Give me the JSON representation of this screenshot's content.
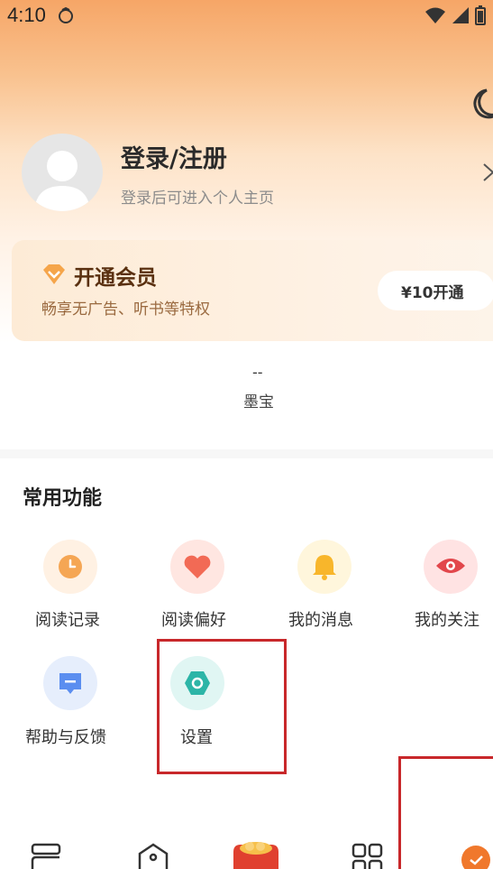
{
  "status_bar": {
    "time": "4:10"
  },
  "profile": {
    "login_title": "登录/注册",
    "login_subtitle": "登录后可进入个人主页"
  },
  "vip": {
    "title": "开通会员",
    "subtitle": "畅享无广告、听书等特权",
    "button_label": "¥10开通"
  },
  "wallet": {
    "value": "--",
    "label": "墨宝"
  },
  "common_functions": {
    "title": "常用功能",
    "items": [
      {
        "label": "阅读记录",
        "icon": "clock-icon"
      },
      {
        "label": "阅读偏好",
        "icon": "heart-icon"
      },
      {
        "label": "我的消息",
        "icon": "bell-icon"
      },
      {
        "label": "我的关注",
        "icon": "eye-icon"
      },
      {
        "label": "帮助与反馈",
        "icon": "feedback-icon"
      },
      {
        "label": "设置",
        "icon": "settings-icon"
      }
    ]
  },
  "colors": {
    "accent": "#f39a5a",
    "highlight": "#c8282b"
  },
  "tab_bar": {
    "icons": [
      "bookshelf-icon",
      "home-icon",
      "gift-icon",
      "grid-icon",
      "profile-icon"
    ]
  }
}
